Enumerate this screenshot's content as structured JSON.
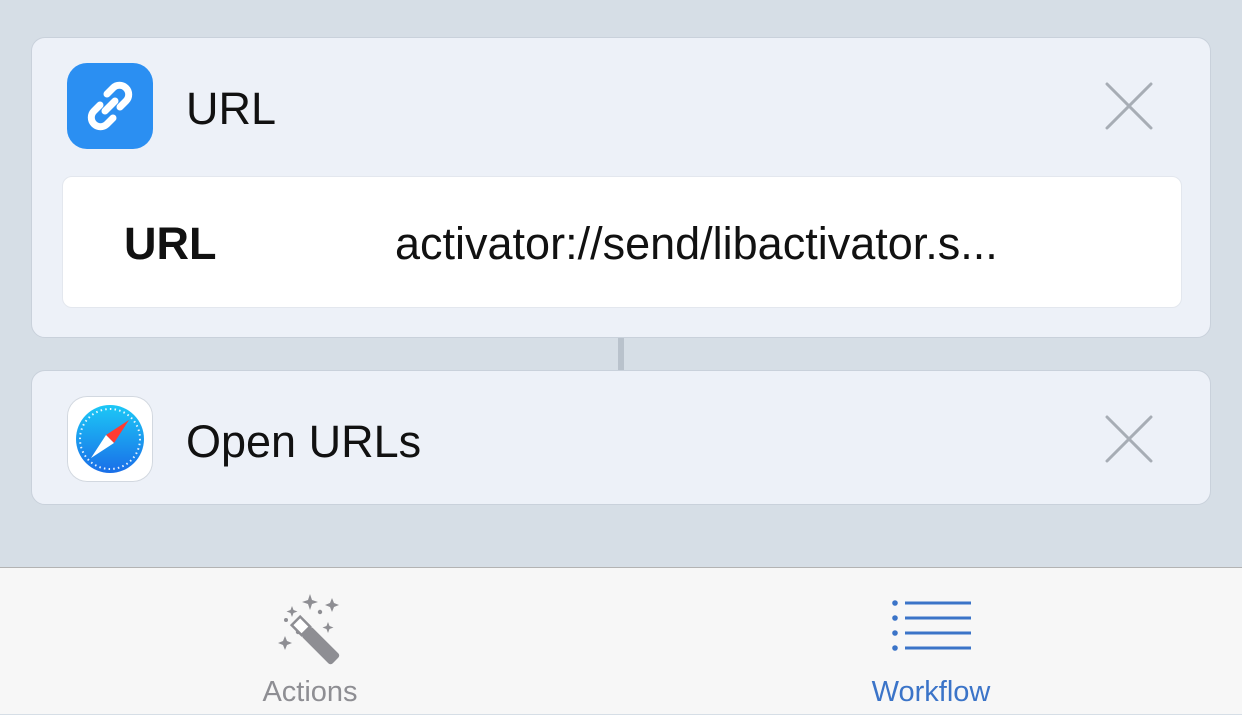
{
  "actions": [
    {
      "title": "URL",
      "icon": "link-icon",
      "icon_color": "#2b8ff2",
      "parameter": {
        "label": "URL",
        "value": "activator://send/libactivator.s..."
      }
    },
    {
      "title": "Open URLs",
      "icon": "safari-compass-icon"
    }
  ],
  "tabbar": {
    "actions_label": "Actions",
    "workflow_label": "Workflow",
    "active_color": "#3b74c8",
    "inactive_color": "#8e8e93"
  }
}
